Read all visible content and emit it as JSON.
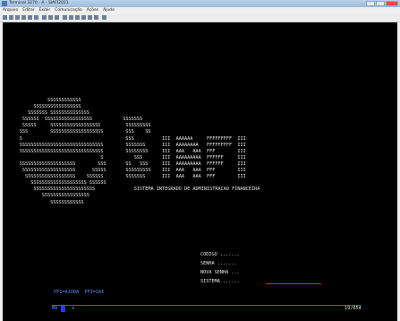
{
  "window": {
    "title": "Terminal 3270 - A - SIAFI2021",
    "buttons": [
      "minimize",
      "maximize",
      "close"
    ]
  },
  "menu": [
    "Arquivo",
    "Editar",
    "Exibir",
    "Comunicação",
    "Ações",
    "Ajuda"
  ],
  "screen": {
    "logo_text": "                SSSSSSSSSSSS\n           SSSSSSSSSSSSSSSSS\n         SSSSSSS SSSSSSSSSSSSSS\n       SSSSSS  SSSSSSSSSSSSSSSSS           SSSSSSS\n       SSSSS     SSSSSSSSSSSSSSSSSS         SSSSSSSSS\n      SSS        SSSSSSSSSSSSSSSSSSS        SSS    SS\n      S                                     SSS          III  AAAAAA     FFFFFFFFF  III\n      SSSSSSSSSSSSSSSSSSSSSSSSSSSSSS        SSSSSSS      III  AAAAAAAA   FFFFFFFFF  III\n      SSSSSSSSSSSSSSSSSSSSSSSSSSSSSS        SSSSSSSS     III  AAA   AAA  FFF        III\n                                   S           SSS       III  AAAAAAAAA  FFFFFF     III\n      SSSSSSSSSSSSSSSSSSSS        SSS       SS   SSS     III  AAAAAAAAA  FFFFFF     III\n       SSSSSSSSSSSSSSSSSSS      SSSSS       SSSSSSSSS    III  AAA   AAA  FFF        III\n        SSSSSSSSSSSSSSSSSS    SSSSSS        SSSSSSS      III  AAA   AAA  FFF        III\n          SSSSSSSSSSSSSSSSSSSS SSSSSS\n           SSSSSSSSSSSSSSSSSSSSSS              SISTEMA INTEGRADO DE ADMINISTRACAO FINANCEIRA\n              SSSSSSSSSSSSSSSSS\n                 SSSSSSSSSSSS",
    "fields": {
      "codigo": "CODIGO .......",
      "senha": "SENHA .......",
      "nova_senha": "NOVA SENHA ...",
      "sistema": "SISTEMA ......"
    },
    "pf_keys": "PF1=AJUDA  PF3=SAI",
    "status_left": "MA",
    "status_mid": "a",
    "status_right": "19/054"
  }
}
